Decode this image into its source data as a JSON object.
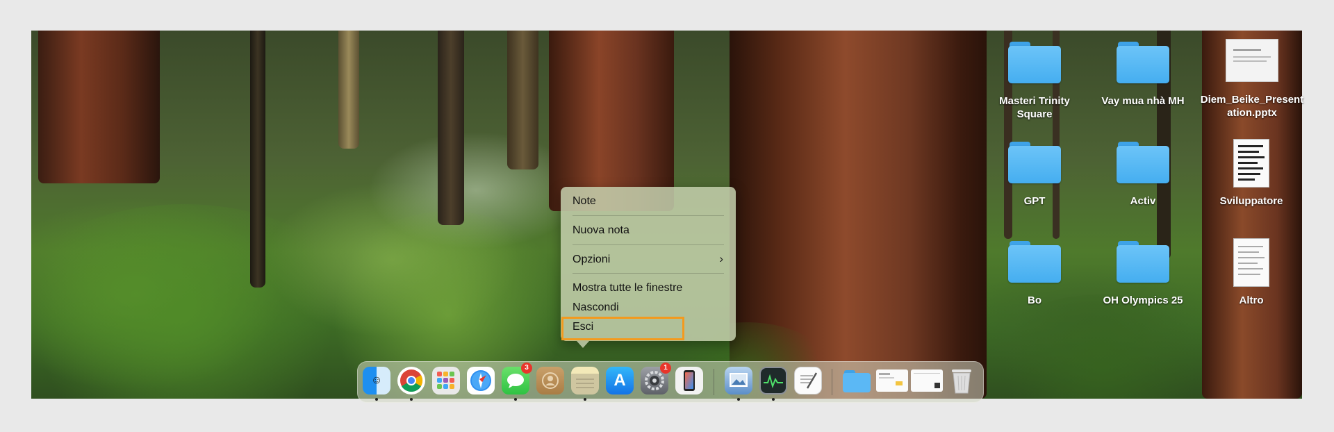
{
  "desktop": {
    "items": [
      {
        "label": "Masteri Trinity Square",
        "icon": "folder-icon"
      },
      {
        "label": "Vay mua nhà MH",
        "icon": "folder-icon"
      },
      {
        "label": "Diem_Beike_Presentation.pptx",
        "icon": "pptx-file-icon"
      },
      {
        "label": "GPT",
        "icon": "folder-icon"
      },
      {
        "label": "Activ",
        "icon": "folder-icon"
      },
      {
        "label": "Sviluppatore",
        "icon": "document-icon"
      },
      {
        "label": "Bo",
        "icon": "folder-icon"
      },
      {
        "label": "OH Olympics 25",
        "icon": "folder-icon"
      },
      {
        "label": "Altro",
        "icon": "document-icon"
      }
    ]
  },
  "context_menu": {
    "items": [
      "Note",
      "Nuova nota",
      "Opzioni",
      "Mostra tutte le finestre",
      "Nascondi",
      "Esci"
    ],
    "submenu_arrow": "›",
    "highlighted": "Esci",
    "highlight_color": "#f39a1e"
  },
  "dock": {
    "apps": [
      "finder-icon",
      "chrome-icon",
      "launchpad-icon",
      "safari-icon",
      "messages-icon",
      "contacts-icon",
      "notes-icon",
      "app-store-icon",
      "system-settings-icon",
      "iphone-mirroring-icon",
      "preview-icon",
      "activity-monitor-icon",
      "textedit-icon",
      "downloads-folder-icon",
      "screenshot-thumb-icon",
      "screenshot-thumb-icon",
      "screenshot-thumb-icon",
      "trash-icon"
    ],
    "badges": {
      "messages": "3",
      "system_settings": "1"
    }
  }
}
